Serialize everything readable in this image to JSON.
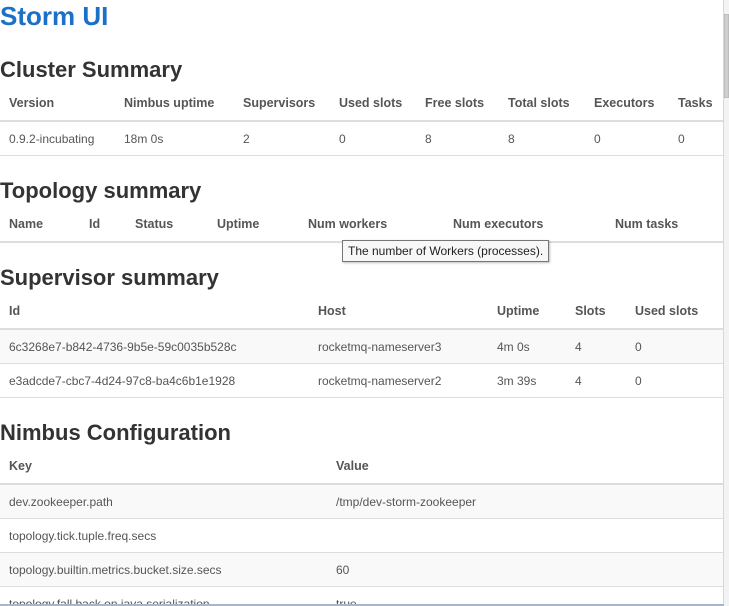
{
  "app": {
    "title": "Storm UI"
  },
  "cluster_summary": {
    "title": "Cluster Summary",
    "headers": [
      "Version",
      "Nimbus uptime",
      "Supervisors",
      "Used slots",
      "Free slots",
      "Total slots",
      "Executors",
      "Tasks"
    ],
    "row": [
      "0.9.2-incubating",
      "18m 0s",
      "2",
      "0",
      "8",
      "8",
      "0",
      "0"
    ]
  },
  "topology_summary": {
    "title": "Topology summary",
    "headers": [
      "Name",
      "Id",
      "Status",
      "Uptime",
      "Num workers",
      "Num executors",
      "Num tasks"
    ],
    "tooltip": "The number of Workers (processes)."
  },
  "supervisor_summary": {
    "title": "Supervisor summary",
    "headers": [
      "Id",
      "Host",
      "Uptime",
      "Slots",
      "Used slots"
    ],
    "rows": [
      [
        "6c3268e7-b842-4736-9b5e-59c0035b528c",
        "rocketmq-nameserver3",
        "4m 0s",
        "4",
        "0"
      ],
      [
        "e3adcde7-cbc7-4d24-97c8-ba4c6b1e1928",
        "rocketmq-nameserver2",
        "3m 39s",
        "4",
        "0"
      ]
    ]
  },
  "nimbus_configuration": {
    "title": "Nimbus Configuration",
    "headers": [
      "Key",
      "Value"
    ],
    "rows": [
      [
        "dev.zookeeper.path",
        "/tmp/dev-storm-zookeeper"
      ],
      [
        "topology.tick.tuple.freq.secs",
        ""
      ],
      [
        "topology.builtin.metrics.bucket.size.secs",
        "60"
      ],
      [
        "topology.fall.back.on.java.serialization",
        "true"
      ]
    ]
  }
}
